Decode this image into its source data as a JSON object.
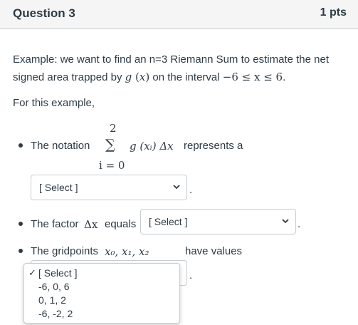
{
  "header": {
    "title": "Question 3",
    "points": "1 pts"
  },
  "prompt": {
    "line1": "Example: we want to find an n=3 Riemann Sum to estimate the net",
    "line2_prefix": "signed area trapped by ",
    "line2_func": "g",
    "line2_arg": "x",
    "line2_mid": " on the interval ",
    "line2_interval": "−6 ≤ x ≤ 6",
    "line2_end": ".",
    "for_this": "For this example,"
  },
  "items": [
    {
      "prefix": "The notation",
      "sum_upper": "2",
      "sum_symbol": "∑",
      "sum_lower": "i = 0",
      "sum_expr": "g (xᵢ) Δx",
      "suffix": "represents a",
      "select_value": "[ Select ]"
    },
    {
      "prefix": "The factor",
      "math": "Δx",
      "suffix": "equals",
      "select_value": "[ Select ]"
    },
    {
      "prefix": "The gridpoints",
      "math": "x₀, x₁, x₂",
      "suffix": "have values"
    }
  ],
  "dropdown": {
    "check": "✓",
    "options": [
      "[ Select ]",
      "-6, 0, 6",
      "0, 1, 2",
      "-6, -2, 2"
    ]
  },
  "period": "."
}
